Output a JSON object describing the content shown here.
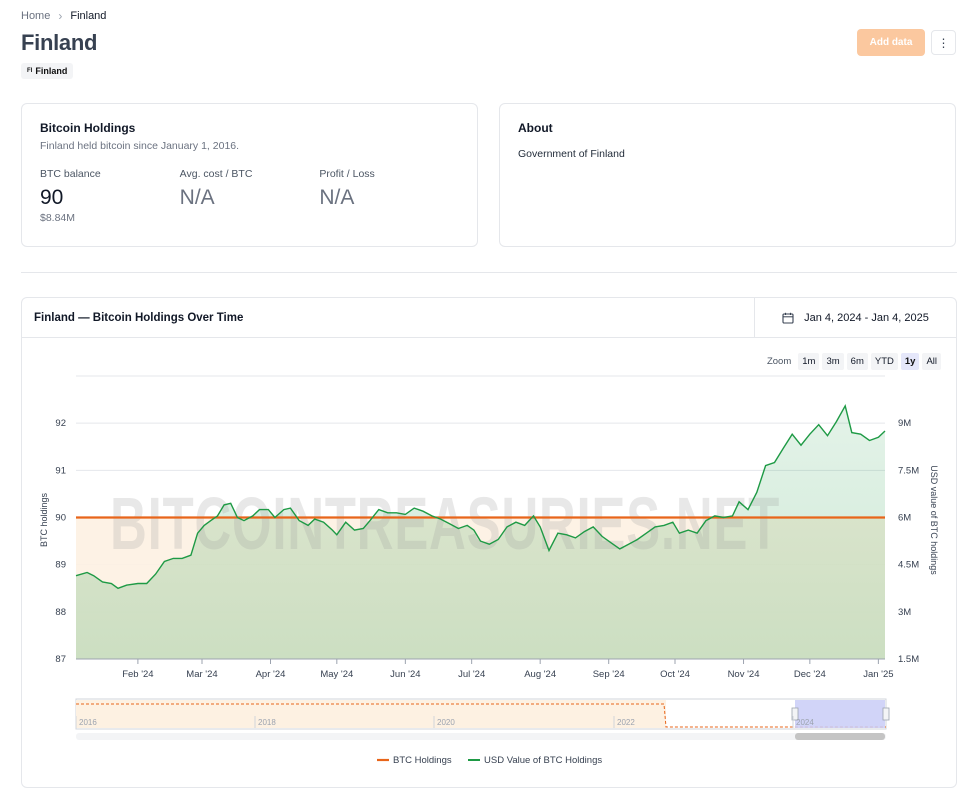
{
  "breadcrumb": {
    "home": "Home",
    "current": "Finland"
  },
  "header": {
    "title": "Finland",
    "tag_code": "FI",
    "tag_label": "Finland",
    "add_label": "Add data",
    "more_label": "⋮"
  },
  "holdings": {
    "title": "Bitcoin Holdings",
    "subtitle": "Finland held bitcoin since January 1, 2016.",
    "btc_balance_label": "BTC balance",
    "btc_balance_value": "90",
    "btc_balance_usd": "$8.84M",
    "avg_cost_label": "Avg. cost / BTC",
    "avg_cost_value": "N/A",
    "profit_label": "Profit / Loss",
    "profit_value": "N/A"
  },
  "about": {
    "title": "About",
    "text": "Government of Finland"
  },
  "chart_card": {
    "title": "Finland — Bitcoin Holdings Over Time",
    "date_range": "Jan 4, 2024 - Jan 4, 2025"
  },
  "zoom": {
    "label": "Zoom",
    "options": [
      "1m",
      "3m",
      "6m",
      "YTD",
      "1y",
      "All"
    ],
    "active": "1y"
  },
  "watermark": "BITCOINTREASURIES.NET",
  "colors": {
    "btc": "#e8651a",
    "usd": "#1e9a45",
    "accent": "#fbc89f",
    "navigator": "#c9cdf7"
  },
  "chart_data": {
    "type": "line",
    "title": "",
    "xlabel": "",
    "ylabel": "BTC holdings",
    "y2label": "USD value of BTC holdings",
    "ylim": [
      87,
      93
    ],
    "y2lim": [
      1500000,
      10500000
    ],
    "x_ticks": [
      "Feb '24",
      "Mar '24",
      "Apr '24",
      "May '24",
      "Jun '24",
      "Jul '24",
      "Aug '24",
      "Sep '24",
      "Oct '24",
      "Nov '24",
      "Dec '24",
      "Jan '25"
    ],
    "y_ticks": [
      "87",
      "88",
      "89",
      "90",
      "91",
      "92"
    ],
    "y2_ticks": [
      "1.5M",
      "3M",
      "4.5M",
      "6M",
      "7.5M",
      "9M"
    ],
    "series": [
      {
        "name": "BTC Holdings",
        "axis": "left",
        "points": [
          [
            "2024-01-04",
            90
          ],
          [
            "2025-01-04",
            90
          ]
        ]
      },
      {
        "name": "USD Value of BTC Holdings",
        "axis": "right",
        "points": [
          [
            "2024-01-04",
            4.15
          ],
          [
            "2024-01-09",
            4.25
          ],
          [
            "2024-01-12",
            4.15
          ],
          [
            "2024-01-16",
            3.95
          ],
          [
            "2024-01-20",
            3.9
          ],
          [
            "2024-01-23",
            3.75
          ],
          [
            "2024-01-27",
            3.85
          ],
          [
            "2024-02-01",
            3.9
          ],
          [
            "2024-02-05",
            3.9
          ],
          [
            "2024-02-09",
            4.2
          ],
          [
            "2024-02-13",
            4.6
          ],
          [
            "2024-02-17",
            4.7
          ],
          [
            "2024-02-21",
            4.7
          ],
          [
            "2024-02-25",
            4.8
          ],
          [
            "2024-02-28",
            5.5
          ],
          [
            "2024-03-02",
            5.75
          ],
          [
            "2024-03-05",
            5.9
          ],
          [
            "2024-03-08",
            6.05
          ],
          [
            "2024-03-11",
            6.4
          ],
          [
            "2024-03-14",
            6.45
          ],
          [
            "2024-03-17",
            6.0
          ],
          [
            "2024-03-20",
            5.9
          ],
          [
            "2024-03-24",
            6.05
          ],
          [
            "2024-03-27",
            6.25
          ],
          [
            "2024-03-31",
            6.25
          ],
          [
            "2024-04-03",
            6.0
          ],
          [
            "2024-04-07",
            6.25
          ],
          [
            "2024-04-10",
            6.3
          ],
          [
            "2024-04-14",
            5.9
          ],
          [
            "2024-04-18",
            5.75
          ],
          [
            "2024-04-21",
            5.95
          ],
          [
            "2024-04-25",
            5.85
          ],
          [
            "2024-04-29",
            5.6
          ],
          [
            "2024-05-01",
            5.45
          ],
          [
            "2024-05-05",
            5.85
          ],
          [
            "2024-05-09",
            5.6
          ],
          [
            "2024-05-13",
            5.65
          ],
          [
            "2024-05-16",
            5.9
          ],
          [
            "2024-05-20",
            6.25
          ],
          [
            "2024-05-24",
            6.15
          ],
          [
            "2024-05-28",
            6.15
          ],
          [
            "2024-06-01",
            6.1
          ],
          [
            "2024-06-05",
            6.3
          ],
          [
            "2024-06-09",
            6.2
          ],
          [
            "2024-06-13",
            6.05
          ],
          [
            "2024-06-17",
            5.95
          ],
          [
            "2024-06-21",
            5.8
          ],
          [
            "2024-06-25",
            5.65
          ],
          [
            "2024-06-29",
            5.75
          ],
          [
            "2024-07-02",
            5.6
          ],
          [
            "2024-07-05",
            5.25
          ],
          [
            "2024-07-09",
            5.15
          ],
          [
            "2024-07-13",
            5.3
          ],
          [
            "2024-07-17",
            5.7
          ],
          [
            "2024-07-21",
            5.85
          ],
          [
            "2024-07-25",
            5.75
          ],
          [
            "2024-07-29",
            6.05
          ],
          [
            "2024-08-01",
            5.7
          ],
          [
            "2024-08-05",
            4.95
          ],
          [
            "2024-08-09",
            5.5
          ],
          [
            "2024-08-13",
            5.45
          ],
          [
            "2024-08-17",
            5.35
          ],
          [
            "2024-08-21",
            5.55
          ],
          [
            "2024-08-25",
            5.7
          ],
          [
            "2024-08-29",
            5.4
          ],
          [
            "2024-09-02",
            5.2
          ],
          [
            "2024-09-06",
            5.0
          ],
          [
            "2024-09-10",
            5.15
          ],
          [
            "2024-09-14",
            5.3
          ],
          [
            "2024-09-18",
            5.5
          ],
          [
            "2024-09-22",
            5.7
          ],
          [
            "2024-09-26",
            5.75
          ],
          [
            "2024-09-30",
            5.85
          ],
          [
            "2024-10-03",
            5.5
          ],
          [
            "2024-10-07",
            5.6
          ],
          [
            "2024-10-11",
            5.5
          ],
          [
            "2024-10-15",
            5.9
          ],
          [
            "2024-10-19",
            6.05
          ],
          [
            "2024-10-23",
            6.0
          ],
          [
            "2024-10-27",
            6.05
          ],
          [
            "2024-10-30",
            6.5
          ],
          [
            "2024-11-03",
            6.25
          ],
          [
            "2024-11-07",
            6.8
          ],
          [
            "2024-11-11",
            7.65
          ],
          [
            "2024-11-15",
            7.75
          ],
          [
            "2024-11-19",
            8.2
          ],
          [
            "2024-11-23",
            8.65
          ],
          [
            "2024-11-27",
            8.3
          ],
          [
            "2024-12-01",
            8.65
          ],
          [
            "2024-12-05",
            8.95
          ],
          [
            "2024-12-09",
            8.6
          ],
          [
            "2024-12-13",
            9.05
          ],
          [
            "2024-12-17",
            9.55
          ],
          [
            "2024-12-20",
            8.7
          ],
          [
            "2024-12-24",
            8.65
          ],
          [
            "2024-12-28",
            8.45
          ],
          [
            "2025-01-01",
            8.55
          ],
          [
            "2025-01-04",
            8.75
          ]
        ]
      }
    ],
    "navigator": {
      "x_ticks": [
        "2016",
        "2018",
        "2020",
        "2022",
        "2024"
      ]
    },
    "legend": {
      "position": "bottom"
    }
  }
}
